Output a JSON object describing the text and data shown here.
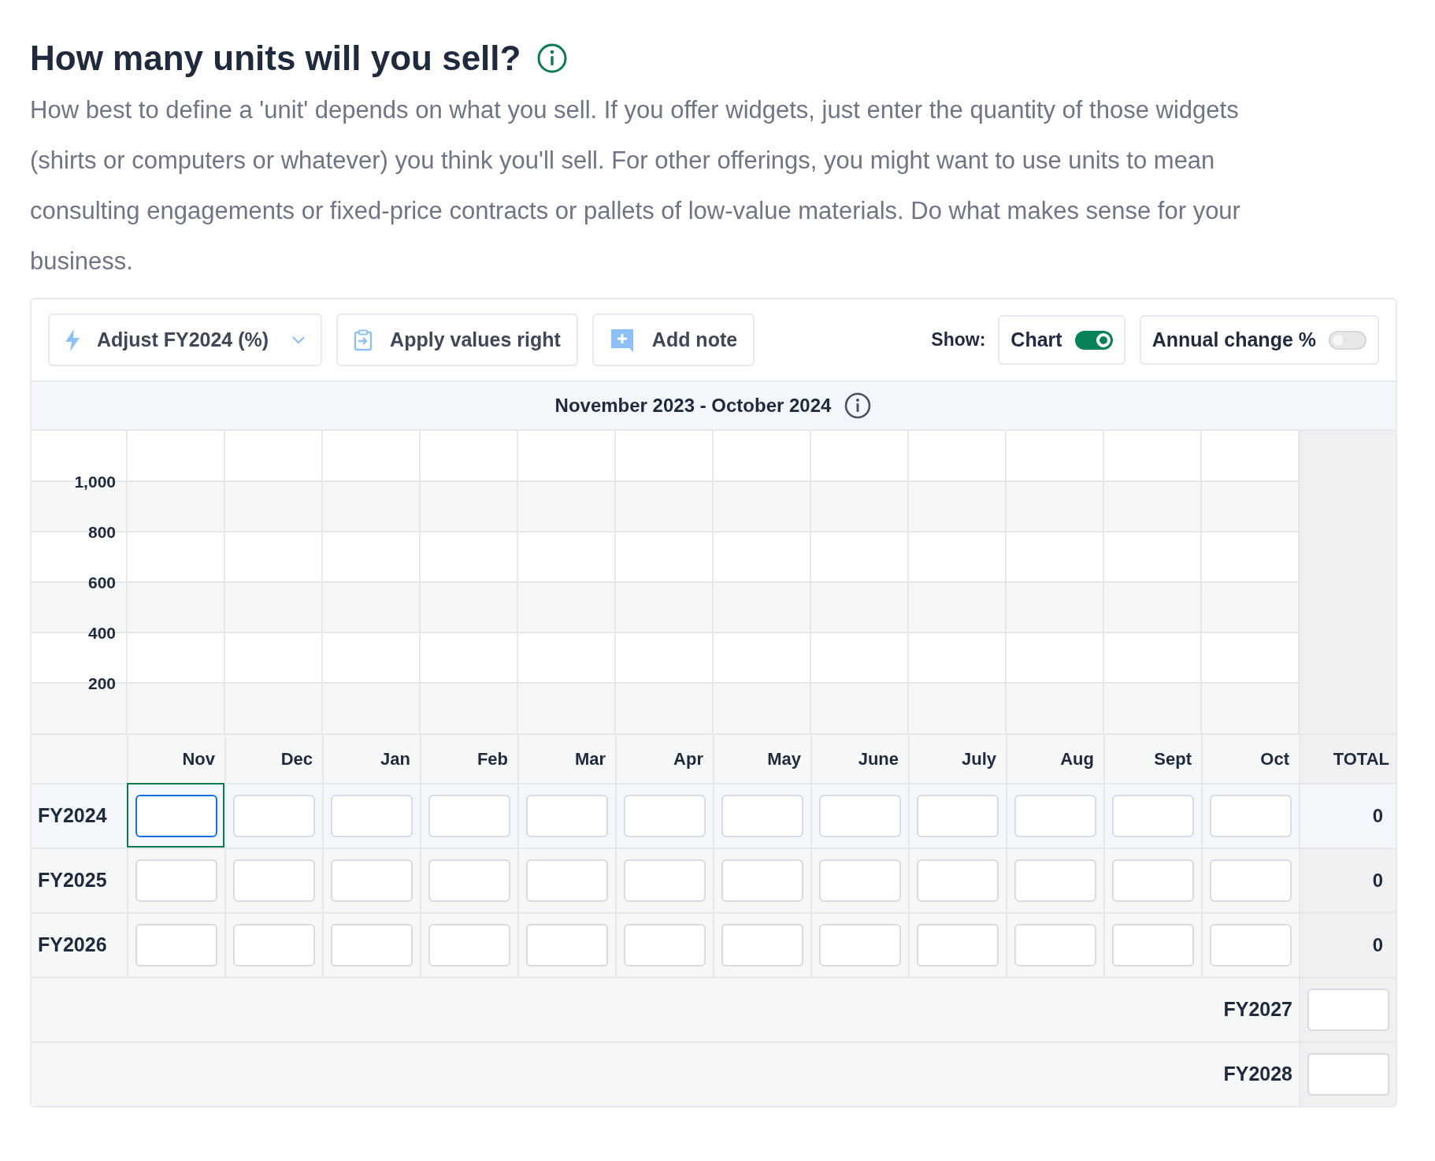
{
  "heading": {
    "title": "How many units will you sell?"
  },
  "description": "How best to define a 'unit' depends on what you sell. If you offer widgets, just enter the quantity of those widgets (shirts or computers or whatever) you think you'll sell. For other offerings, you might want to use units to mean consulting engagements or fixed-price contracts or pallets of low-value materials. Do what makes sense for your business.",
  "toolbar": {
    "buttons": [
      {
        "kind": "dropdown",
        "label": "Adjust FY2024 (%)"
      },
      {
        "kind": "apply",
        "label": "Apply values right"
      },
      {
        "kind": "note",
        "label": "Add note"
      }
    ],
    "show_label": "Show:",
    "toggles": [
      {
        "label": "Chart",
        "on": true
      },
      {
        "label": "Annual change %",
        "on": false
      }
    ]
  },
  "period": "November 2023 - October 2024",
  "chart": {
    "axis_labels": [
      "1,000",
      "800",
      "600",
      "400",
      "200"
    ]
  },
  "table": {
    "columns": [
      "Nov",
      "Dec",
      "Jan",
      "Feb",
      "Mar",
      "Apr",
      "May",
      "June",
      "July",
      "Aug",
      "Sept",
      "Oct"
    ],
    "total_label": "TOTAL",
    "rows": [
      {
        "label": "FY2024",
        "total": "0",
        "cells": [
          {
            "focused": true
          },
          {
            "focused": false
          },
          {
            "focused": false
          },
          {
            "focused": false
          },
          {
            "focused": false
          },
          {
            "focused": false
          },
          {
            "focused": false
          },
          {
            "focused": false
          },
          {
            "focused": false
          },
          {
            "focused": false
          },
          {
            "focused": false
          },
          {
            "focused": false
          }
        ]
      },
      {
        "label": "FY2025",
        "total": "0",
        "cells": [
          {
            "focused": false
          },
          {
            "focused": false
          },
          {
            "focused": false
          },
          {
            "focused": false
          },
          {
            "focused": false
          },
          {
            "focused": false
          },
          {
            "focused": false
          },
          {
            "focused": false
          },
          {
            "focused": false
          },
          {
            "focused": false
          },
          {
            "focused": false
          },
          {
            "focused": false
          }
        ]
      },
      {
        "label": "FY2026",
        "total": "0",
        "cells": [
          {
            "focused": false
          },
          {
            "focused": false
          },
          {
            "focused": false
          },
          {
            "focused": false
          },
          {
            "focused": false
          },
          {
            "focused": false
          },
          {
            "focused": false
          },
          {
            "focused": false
          },
          {
            "focused": false
          },
          {
            "focused": false
          },
          {
            "focused": false
          },
          {
            "focused": false
          }
        ]
      }
    ],
    "annual_rows": [
      {
        "label": "FY2027"
      },
      {
        "label": "FY2028"
      }
    ]
  }
}
